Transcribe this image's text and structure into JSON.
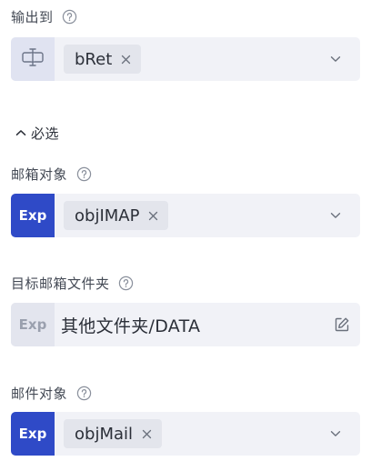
{
  "output": {
    "label": "输出到",
    "help_icon": "question-circle-icon",
    "prefix_icon": "variable-cursor-icon",
    "tag_value": "bRet"
  },
  "section": {
    "toggle_icon": "chevron-up-icon",
    "label": "必选"
  },
  "mailbox_object": {
    "label": "邮箱对象",
    "prefix": "Exp",
    "tag_value": "objIMAP"
  },
  "target_folder": {
    "label": "目标邮箱文件夹",
    "prefix": "Exp",
    "value": "其他文件夹/DATA",
    "edit_icon": "edit-icon"
  },
  "mail_object": {
    "label": "邮件对象",
    "prefix": "Exp",
    "tag_value": "objMail"
  },
  "colors": {
    "exp_active": "#2f4ac7",
    "field_bg": "#f1f2f7",
    "tag_bg": "#e3e5ec"
  }
}
